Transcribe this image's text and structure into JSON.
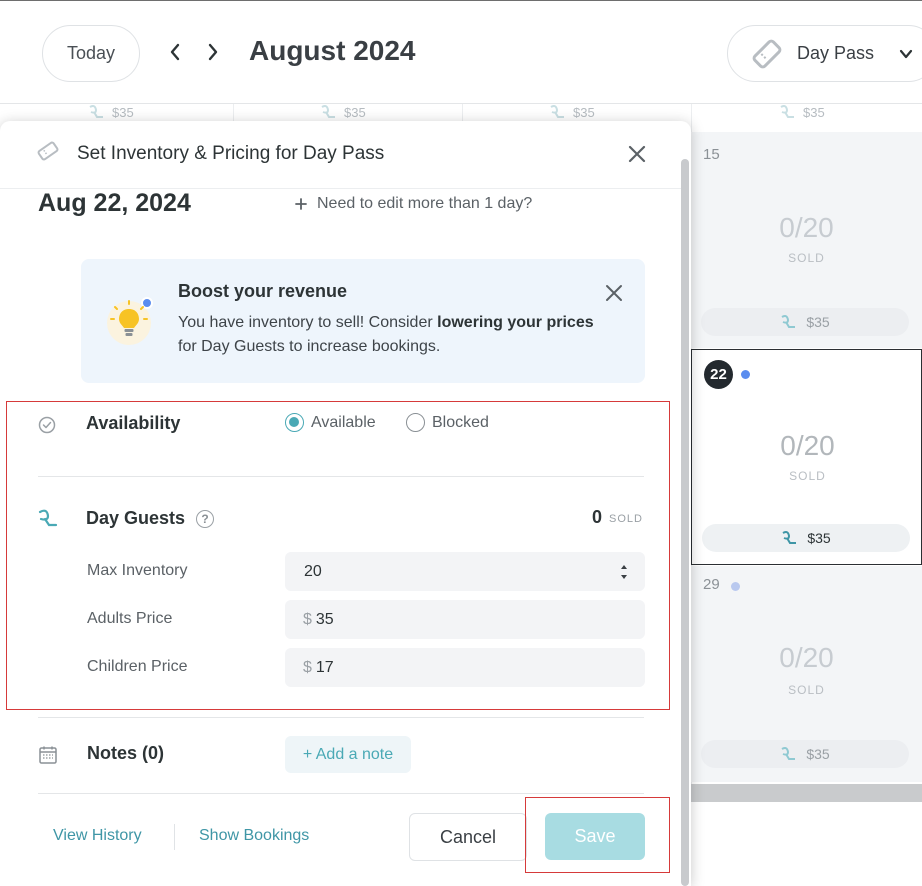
{
  "header": {
    "today_label": "Today",
    "month_title": "August 2024",
    "pass_select": "Day Pass"
  },
  "calendar": {
    "strip_price": "$35",
    "cells": [
      {
        "date": "15",
        "count": "0/20",
        "sold": "SOLD",
        "price": "$35",
        "selected": false
      },
      {
        "date": "22",
        "count": "0/20",
        "sold": "SOLD",
        "price": "$35",
        "selected": true
      },
      {
        "date": "29",
        "count": "0/20",
        "sold": "SOLD",
        "price": "$35",
        "selected": false
      }
    ]
  },
  "modal": {
    "title": "Set Inventory & Pricing for Day Pass",
    "date": "Aug 22, 2024",
    "edit_link": "Need to edit more than 1 day?",
    "boost": {
      "title": "Boost your revenue",
      "text_before": "You have inventory to sell! Consider ",
      "text_bold": "lowering your prices",
      "text_after": " for Day Guests to increase bookings."
    },
    "availability": {
      "label": "Availability",
      "options": [
        "Available",
        "Blocked"
      ],
      "selected": "Available"
    },
    "day_guests": {
      "label": "Day Guests",
      "sold_count": "0",
      "sold_word": "SOLD",
      "max_inventory_label": "Max Inventory",
      "max_inventory_value": "20",
      "adults_price_label": "Adults Price",
      "adults_price_value": "35",
      "children_price_label": "Children Price",
      "children_price_value": "17",
      "currency": "$"
    },
    "notes": {
      "label": "Notes (0)",
      "add_label": "+ Add a note"
    },
    "footer": {
      "view_history": "View History",
      "show_bookings": "Show Bookings",
      "cancel": "Cancel",
      "save": "Save"
    }
  },
  "colors": {
    "accent": "#4aa9b5",
    "save_disabled": "#a8dce2",
    "boost_bg": "#eef5fc",
    "highlight_red": "#d63a3a",
    "dot_blue": "#5b8def"
  },
  "icons": {
    "prev": "chevron-left-icon",
    "next": "chevron-right-icon",
    "pass": "tag-icon",
    "close": "close-icon",
    "bulb": "lightbulb-icon",
    "availability": "check-circle-icon",
    "guests": "guests-icon",
    "help": "question-circle-icon",
    "notes": "calendar-notes-icon"
  }
}
